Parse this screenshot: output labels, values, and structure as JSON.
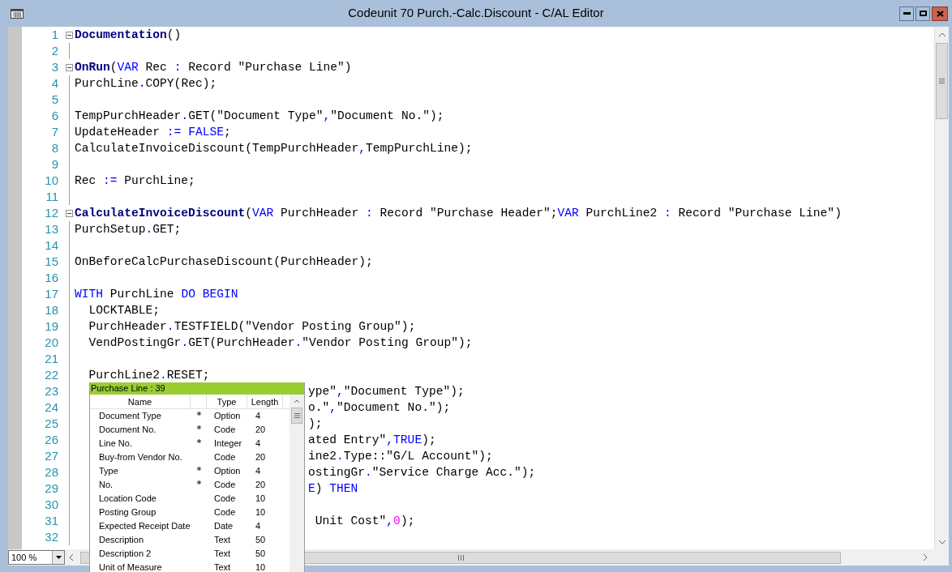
{
  "window": {
    "title": "Codeunit 70 Purch.-Calc.Discount - C/AL Editor"
  },
  "editor": {
    "lines": [
      {
        "number": "1",
        "fold_start": true,
        "partly_hidden": false,
        "tokens": [
          {
            "kind": "function",
            "text": "Documentation"
          },
          {
            "kind": "plain",
            "text": "()"
          }
        ]
      },
      {
        "number": "2",
        "fold_start": false
      },
      {
        "number": "3",
        "fold_start": true,
        "partly_hidden": false,
        "tokens": [
          {
            "kind": "function",
            "text": "OnRun"
          },
          {
            "kind": "plain",
            "text": "("
          },
          {
            "kind": "keyword",
            "text": "VAR"
          },
          {
            "kind": "plain",
            "text": " Rec "
          },
          {
            "kind": "operator",
            "text": ":"
          },
          {
            "kind": "plain",
            "text": " Record \"Purchase Line\")"
          }
        ]
      },
      {
        "number": "4",
        "fold_start": false,
        "partly_hidden": false,
        "tokens": [
          {
            "kind": "plain",
            "text": "PurchLine"
          },
          {
            "kind": "operator",
            "text": "."
          },
          {
            "kind": "plain",
            "text": "COPY(Rec);"
          }
        ]
      },
      {
        "number": "5",
        "fold_start": false
      },
      {
        "number": "6",
        "fold_start": false,
        "partly_hidden": false,
        "tokens": [
          {
            "kind": "plain",
            "text": "TempPurchHeader"
          },
          {
            "kind": "operator",
            "text": "."
          },
          {
            "kind": "plain",
            "text": "GET(\"Document Type\""
          },
          {
            "kind": "operator",
            "text": ","
          },
          {
            "kind": "plain",
            "text": "\"Document No.\");"
          }
        ]
      },
      {
        "number": "7",
        "fold_start": false,
        "partly_hidden": false,
        "tokens": [
          {
            "kind": "plain",
            "text": "UpdateHeader "
          },
          {
            "kind": "operator",
            "text": ":= "
          },
          {
            "kind": "keyword",
            "text": "FALSE"
          },
          {
            "kind": "plain",
            "text": ";"
          }
        ]
      },
      {
        "number": "8",
        "fold_start": false,
        "partly_hidden": false,
        "tokens": [
          {
            "kind": "plain",
            "text": "CalculateInvoiceDiscount(TempPurchHeader"
          },
          {
            "kind": "operator",
            "text": ","
          },
          {
            "kind": "plain",
            "text": "TempPurchLine);"
          }
        ]
      },
      {
        "number": "9",
        "fold_start": false
      },
      {
        "number": "10",
        "fold_start": false,
        "partly_hidden": false,
        "tokens": [
          {
            "kind": "plain",
            "text": "Rec "
          },
          {
            "kind": "operator",
            "text": ":="
          },
          {
            "kind": "plain",
            "text": " PurchLine;"
          }
        ]
      },
      {
        "number": "11",
        "fold_start": false
      },
      {
        "number": "12",
        "fold_start": true,
        "partly_hidden": false,
        "tokens": [
          {
            "kind": "function",
            "text": "CalculateInvoiceDiscount"
          },
          {
            "kind": "plain",
            "text": "("
          },
          {
            "kind": "keyword",
            "text": "VAR"
          },
          {
            "kind": "plain",
            "text": " PurchHeader "
          },
          {
            "kind": "operator",
            "text": ":"
          },
          {
            "kind": "plain",
            "text": " Record \"Purchase Header\";"
          },
          {
            "kind": "keyword",
            "text": "VAR"
          },
          {
            "kind": "plain",
            "text": " PurchLine2 "
          },
          {
            "kind": "operator",
            "text": ":"
          },
          {
            "kind": "plain",
            "text": " Record \"Purchase Line\")"
          }
        ]
      },
      {
        "number": "13",
        "fold_start": false,
        "partly_hidden": false,
        "tokens": [
          {
            "kind": "plain",
            "text": "PurchSetup"
          },
          {
            "kind": "operator",
            "text": "."
          },
          {
            "kind": "plain",
            "text": "GET;"
          }
        ]
      },
      {
        "number": "14",
        "fold_start": false
      },
      {
        "number": "15",
        "fold_start": false,
        "partly_hidden": false,
        "tokens": [
          {
            "kind": "plain",
            "text": "OnBeforeCalcPurchaseDiscount(PurchHeader);"
          }
        ]
      },
      {
        "number": "16",
        "fold_start": false
      },
      {
        "number": "17",
        "fold_start": false,
        "partly_hidden": false,
        "tokens": [
          {
            "kind": "keyword",
            "text": "WITH"
          },
          {
            "kind": "plain",
            "text": " PurchLine "
          },
          {
            "kind": "keyword",
            "text": "DO BEGIN"
          }
        ]
      },
      {
        "number": "18",
        "fold_start": false,
        "partly_hidden": false,
        "tokens": [
          {
            "kind": "plain",
            "text": "  LOCKTABLE;"
          }
        ]
      },
      {
        "number": "19",
        "fold_start": false,
        "partly_hidden": false,
        "tokens": [
          {
            "kind": "plain",
            "text": "  PurchHeader"
          },
          {
            "kind": "operator",
            "text": "."
          },
          {
            "kind": "plain",
            "text": "TESTFIELD(\"Vendor Posting Group\");"
          }
        ]
      },
      {
        "number": "20",
        "fold_start": false,
        "partly_hidden": false,
        "tokens": [
          {
            "kind": "plain",
            "text": "  VendPostingGr"
          },
          {
            "kind": "operator",
            "text": "."
          },
          {
            "kind": "plain",
            "text": "GET(PurchHeader"
          },
          {
            "kind": "operator",
            "text": "."
          },
          {
            "kind": "plain",
            "text": "\"Vendor Posting Group\");"
          }
        ]
      },
      {
        "number": "21",
        "fold_start": false
      },
      {
        "number": "22",
        "fold_start": false,
        "partly_hidden": false,
        "tokens": [
          {
            "kind": "plain",
            "text": "  PurchLine2"
          },
          {
            "kind": "operator",
            "text": "."
          },
          {
            "kind": "plain",
            "text": "RESET;"
          }
        ]
      },
      {
        "number": "23",
        "fold_start": false,
        "partly_hidden": true,
        "tokens": [
          {
            "kind": "plain",
            "text": "ype\""
          },
          {
            "kind": "operator",
            "text": ","
          },
          {
            "kind": "plain",
            "text": "\"Document Type\");"
          }
        ]
      },
      {
        "number": "24",
        "fold_start": false,
        "partly_hidden": true,
        "tokens": [
          {
            "kind": "plain",
            "text": "o.\""
          },
          {
            "kind": "operator",
            "text": ","
          },
          {
            "kind": "plain",
            "text": "\"Document No.\");"
          }
        ]
      },
      {
        "number": "25",
        "fold_start": false,
        "partly_hidden": true,
        "tokens": [
          {
            "kind": "plain",
            "text": ");"
          }
        ]
      },
      {
        "number": "26",
        "fold_start": false,
        "partly_hidden": true,
        "tokens": [
          {
            "kind": "plain",
            "text": "ated Entry\""
          },
          {
            "kind": "operator",
            "text": ","
          },
          {
            "kind": "keyword",
            "text": "TRUE"
          },
          {
            "kind": "plain",
            "text": ");"
          }
        ]
      },
      {
        "number": "27",
        "fold_start": false,
        "partly_hidden": true,
        "tokens": [
          {
            "kind": "plain",
            "text": "ine2"
          },
          {
            "kind": "operator",
            "text": "."
          },
          {
            "kind": "plain",
            "text": "Type::\"G/L Account\");"
          }
        ]
      },
      {
        "number": "28",
        "fold_start": false,
        "partly_hidden": true,
        "tokens": [
          {
            "kind": "plain",
            "text": "ostingGr"
          },
          {
            "kind": "operator",
            "text": "."
          },
          {
            "kind": "plain",
            "text": "\"Service Charge Acc.\");"
          }
        ]
      },
      {
        "number": "29",
        "fold_start": false,
        "partly_hidden": true,
        "tokens": [
          {
            "kind": "keyword",
            "text": "E"
          },
          {
            "kind": "plain",
            "text": ") "
          },
          {
            "kind": "keyword",
            "text": "THEN"
          }
        ]
      },
      {
        "number": "30",
        "fold_start": false
      },
      {
        "number": "31",
        "fold_start": false,
        "partly_hidden": true,
        "tokens": [
          {
            "kind": "plain",
            "text": " Unit Cost\""
          },
          {
            "kind": "operator",
            "text": ","
          },
          {
            "kind": "number",
            "text": "0"
          },
          {
            "kind": "plain",
            "text": ");"
          }
        ]
      },
      {
        "number": "32",
        "fold_start": false
      }
    ]
  },
  "zoom_box": {
    "value": "100 %"
  },
  "field_list": {
    "title": "Purchase Line : 39",
    "columns": [
      "Name",
      "Type",
      "Length"
    ],
    "rows": [
      {
        "name": "Document Type",
        "primary_key": true,
        "type": "Option",
        "length": "4"
      },
      {
        "name": "Document No.",
        "primary_key": true,
        "type": "Code",
        "length": "20"
      },
      {
        "name": "Line No.",
        "primary_key": true,
        "type": "Integer",
        "length": "4"
      },
      {
        "name": "Buy-from Vendor No.",
        "primary_key": false,
        "type": "Code",
        "length": "20"
      },
      {
        "name": "Type",
        "primary_key": true,
        "type": "Option",
        "length": "4"
      },
      {
        "name": "No.",
        "primary_key": true,
        "type": "Code",
        "length": "20"
      },
      {
        "name": "Location Code",
        "primary_key": false,
        "type": "Code",
        "length": "10"
      },
      {
        "name": "Posting Group",
        "primary_key": false,
        "type": "Code",
        "length": "10"
      },
      {
        "name": "Expected Receipt Date",
        "primary_key": false,
        "type": "Date",
        "length": "4"
      },
      {
        "name": "Description",
        "primary_key": false,
        "type": "Text",
        "length": "50"
      },
      {
        "name": "Description 2",
        "primary_key": false,
        "type": "Text",
        "length": "50"
      },
      {
        "name": "Unit of Measure",
        "primary_key": false,
        "type": "Text",
        "length": "10"
      }
    ]
  }
}
